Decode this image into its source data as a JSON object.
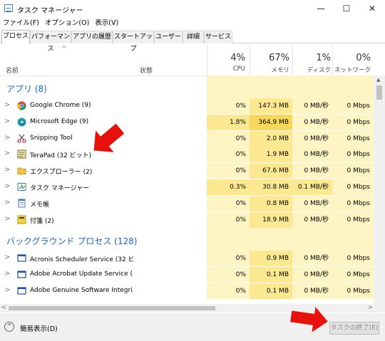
{
  "window": {
    "title": "タスク マネージャー",
    "minimize": "—",
    "maximize": "☐",
    "close": "✕"
  },
  "menu": [
    "ファイル(F)",
    "オプション(O)",
    "表示(V)"
  ],
  "tabs": [
    "プロセス",
    "パフォーマンス",
    "アプリの履歴",
    "スタートアップ",
    "ユーザー",
    "詳細",
    "サービス"
  ],
  "header": {
    "name": "名前",
    "status": "状態",
    "cpu": {
      "pct": "4%",
      "label": "CPU"
    },
    "memory": {
      "pct": "67%",
      "label": "メモリ"
    },
    "disk": {
      "pct": "1%",
      "label": "ディスク"
    },
    "network": {
      "pct": "0%",
      "label": "ネットワーク"
    }
  },
  "groups": {
    "apps": "アプリ (8)",
    "background": "バックグラウンド プロセス (128)"
  },
  "apps": [
    {
      "name": "Google Chrome (9)",
      "icon": "chrome-icon",
      "cpu": "0%",
      "mem": "147.3 MB",
      "disk": "0 MB/秒",
      "net": "0 Mbps"
    },
    {
      "name": "Microsoft Edge (9)",
      "icon": "edge-icon",
      "cpu": "1.8%",
      "mem": "364.9 MB",
      "disk": "0 MB/秒",
      "net": "0 Mbps"
    },
    {
      "name": "Snipping Tool",
      "icon": "scissors-icon",
      "cpu": "0%",
      "mem": "2.0 MB",
      "disk": "0 MB/秒",
      "net": "0 Mbps"
    },
    {
      "name": "TeraPad (32 ビット)",
      "icon": "terapad-icon",
      "cpu": "0%",
      "mem": "1.9 MB",
      "disk": "0 MB/秒",
      "net": "0 Mbps"
    },
    {
      "name": "エクスプローラー (2)",
      "icon": "folder-icon",
      "cpu": "0%",
      "mem": "67.6 MB",
      "disk": "0 MB/秒",
      "net": "0 Mbps"
    },
    {
      "name": "タスク マネージャー",
      "icon": "task-manager-icon",
      "cpu": "0.3%",
      "mem": "30.8 MB",
      "disk": "0.1 MB/秒",
      "net": "0 Mbps"
    },
    {
      "name": "メモ帳",
      "icon": "notepad-icon",
      "cpu": "0%",
      "mem": "0.8 MB",
      "disk": "0 MB/秒",
      "net": "0 Mbps"
    },
    {
      "name": "付箋 (2)",
      "icon": "sticky-notes-icon",
      "cpu": "0%",
      "mem": "18.9 MB",
      "disk": "0 MB/秒",
      "net": "0 Mbps"
    }
  ],
  "background": [
    {
      "name": "Acronis Scheduler Service (32 ビ...",
      "icon": "service-icon",
      "cpu": "0%",
      "mem": "0.9 MB",
      "disk": "0 MB/秒",
      "net": "0 Mbps"
    },
    {
      "name": "Adobe Acrobat Update Service (...",
      "icon": "service-icon",
      "cpu": "0%",
      "mem": "0.1 MB",
      "disk": "0 MB/秒",
      "net": "0 Mbps"
    },
    {
      "name": "Adobe Genuine Software Integri...",
      "icon": "service-icon",
      "cpu": "0%",
      "mem": "0.1 MB",
      "disk": "0 MB/秒",
      "net": "0 Mbps"
    }
  ],
  "footer": {
    "fewer_details": "簡易表示(D)",
    "end_task": "タスクの終了(E)"
  },
  "colors": {
    "group": "#1b64c8",
    "heat_light": "#fff4c4",
    "heat_mid": "#fce891",
    "heat_strong": "#f8d85c",
    "arrow": "#e8120c"
  }
}
